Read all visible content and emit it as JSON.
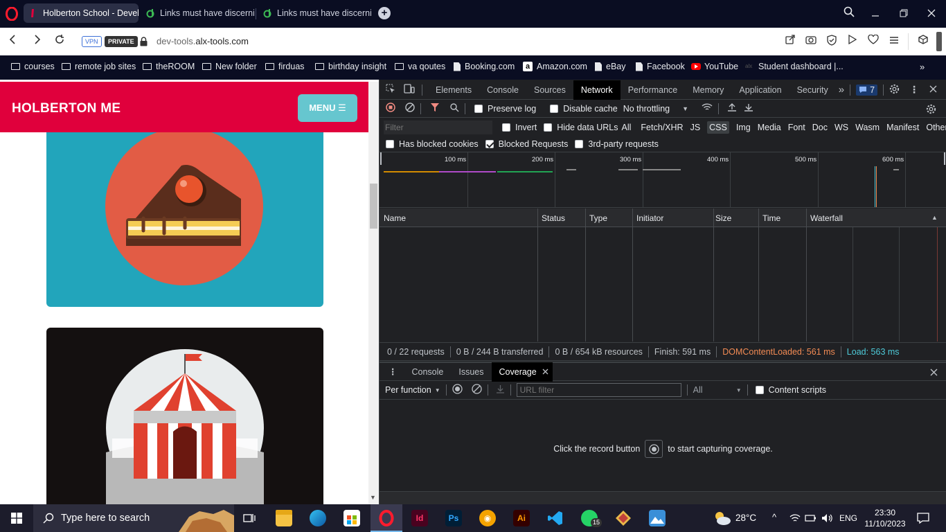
{
  "tabs": [
    {
      "title": "Holberton School - Devel"
    },
    {
      "title": "Links must have discernib"
    },
    {
      "title": "Links must have discernib"
    }
  ],
  "address": {
    "vpn": "VPN",
    "private": "PRIVATE",
    "url_prefix": "dev-tools.",
    "url_domain": "alx-tools.com"
  },
  "bookmarks": [
    {
      "label": "courses",
      "icon": "folder-icon"
    },
    {
      "label": "remote job sites",
      "icon": "folder-icon"
    },
    {
      "label": "theROOM",
      "icon": "folder-icon"
    },
    {
      "label": "New folder",
      "icon": "folder-icon"
    },
    {
      "label": "firduas",
      "icon": "folder-icon"
    },
    {
      "label": "birthday insight",
      "icon": "folder-icon"
    },
    {
      "label": "va qoutes",
      "icon": "folder-icon"
    },
    {
      "label": "Booking.com",
      "icon": "page-icon"
    },
    {
      "label": "Amazon.com",
      "icon": "amazon-icon"
    },
    {
      "label": "eBay",
      "icon": "page-icon"
    },
    {
      "label": "Facebook",
      "icon": "page-icon"
    },
    {
      "label": "YouTube",
      "icon": "youtube-icon"
    },
    {
      "label": "Student dashboard |...",
      "icon": "alx-icon"
    }
  ],
  "site": {
    "brand": "HOLBERTON ME",
    "menu_label": "MENU ☰"
  },
  "devtools": {
    "tabs": [
      "Elements",
      "Console",
      "Sources",
      "Network",
      "Performance",
      "Memory",
      "Application",
      "Security"
    ],
    "active_tab": "Network",
    "issues_count": "7",
    "toolbar": {
      "preserve_log": "Preserve log",
      "disable_cache": "Disable cache",
      "throttling": "No throttling"
    },
    "filter": {
      "placeholder": "Filter",
      "invert": "Invert",
      "hide_data_urls": "Hide data URLs",
      "types": [
        "All",
        "Fetch/XHR",
        "JS",
        "CSS",
        "Img",
        "Media",
        "Font",
        "Doc",
        "WS",
        "Wasm",
        "Manifest",
        "Other"
      ],
      "selected_type": "CSS",
      "has_blocked_cookies": "Has blocked cookies",
      "blocked_requests": "Blocked Requests",
      "third_party": "3rd-party requests"
    },
    "timeline_ticks": [
      "100 ms",
      "200 ms",
      "300 ms",
      "400 ms",
      "500 ms",
      "600 ms"
    ],
    "columns": [
      "Name",
      "Status",
      "Type",
      "Initiator",
      "Size",
      "Time",
      "Waterfall"
    ],
    "status_bar": {
      "requests": "0 / 22 requests",
      "transferred": "0 B / 244 B transferred",
      "resources": "0 B / 654 kB resources",
      "finish": "Finish: 591 ms",
      "dom_loaded": "DOMContentLoaded: 561 ms",
      "load": "Load: 563 ms"
    },
    "drawer_tabs": [
      "Console",
      "Issues",
      "Coverage"
    ],
    "drawer_active": "Coverage",
    "coverage": {
      "mode": "Per function",
      "url_placeholder": "URL filter",
      "type": "All",
      "content_scripts": "Content scripts",
      "hint_before": "Click the record button",
      "hint_after": "to start capturing coverage."
    },
    "colors": {
      "dom_loaded": "#f28b54",
      "load": "#4ecbd9"
    }
  },
  "taskbar": {
    "search_placeholder": "Type here to search",
    "weather": "28°C",
    "language": "ENG",
    "time": "23:30",
    "date": "11/10/2023",
    "whatsapp_badge": "15"
  }
}
